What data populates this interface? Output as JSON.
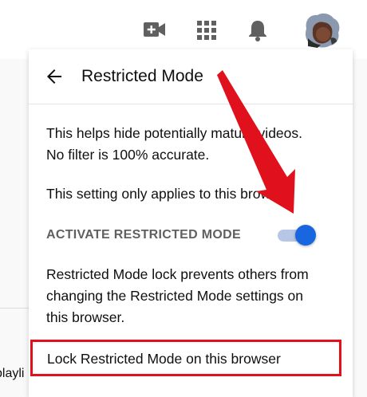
{
  "topbar": {
    "create_icon": "video-camera-plus-icon",
    "apps_icon": "apps-grid-icon",
    "notifications_icon": "bell-icon",
    "avatar_icon": "user-avatar"
  },
  "background": {
    "partial_text": "playli"
  },
  "panel": {
    "back_icon": "arrow-left-icon",
    "title": "Restricted Mode",
    "description_line1": "This helps hide potentially mature videos.",
    "description_line2": "No filter is 100% accurate.",
    "scope_note": "This setting only applies to this browser.",
    "activate_label": "ACTIVATE RESTRICTED MODE",
    "toggle_on": true,
    "lock_description_line1": "Restricted Mode lock prevents others from",
    "lock_description_line2": "changing the Restricted Mode settings on",
    "lock_description_line3": "this browser.",
    "lock_action": "Lock Restricted Mode on this browser"
  },
  "colors": {
    "accent_blue": "#1967e0",
    "annotation_red": "#e0101c",
    "text": "#0f0f0f",
    "muted_text": "#606060"
  }
}
